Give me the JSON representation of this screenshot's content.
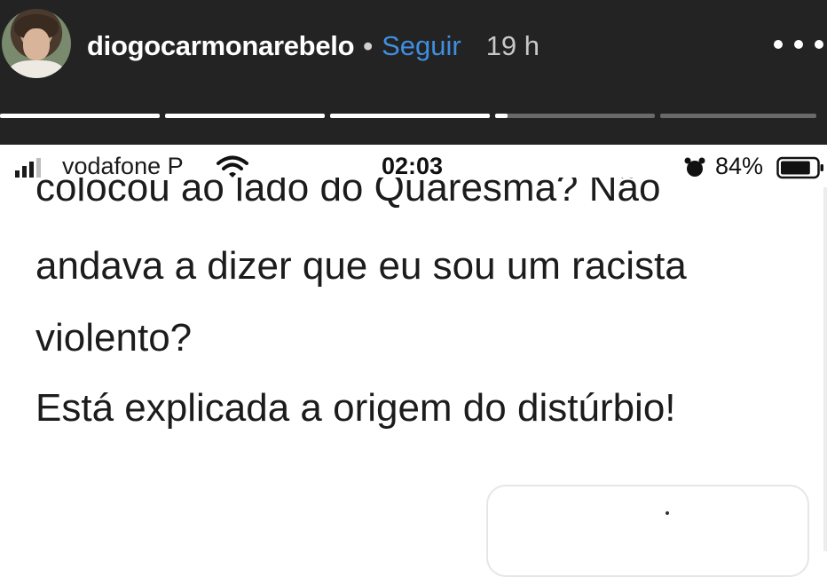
{
  "story": {
    "username": "diogocarmonarebelo",
    "separator": "•",
    "follow_label": "Seguir",
    "time": "19 h",
    "progress_segments": [
      {
        "state": "done"
      },
      {
        "state": "done"
      },
      {
        "state": "done"
      },
      {
        "state": "current"
      },
      {
        "state": "pending"
      }
    ]
  },
  "status_bar": {
    "carrier": "vodafone P",
    "clock": "02:03",
    "battery": "84%",
    "battery_level": 0.84,
    "signal_icon": "signal-bars-icon",
    "wifi_icon": "wifi-icon",
    "alarm_icon": "alarm-icon"
  },
  "tweet": {
    "partial_line": "colocou ao lado do Quaresma? Não",
    "lines": [
      "andava a dizer que eu sou um racista",
      "violento?",
      "Está explicada a origem do distúrbio!"
    ]
  },
  "colors": {
    "header_bg": "#232323",
    "follow": "#3f8ee0",
    "text": "#1c1c1c"
  }
}
